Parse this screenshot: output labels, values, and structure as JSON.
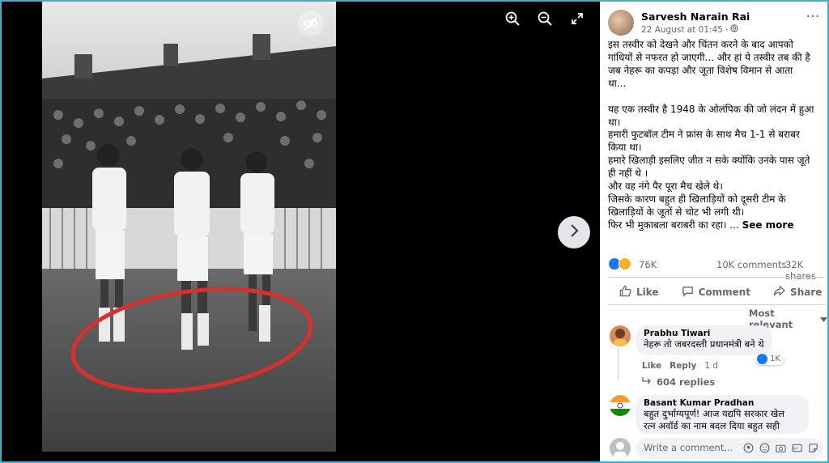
{
  "post": {
    "author": "Sarvesh Narain Rai",
    "timestamp": "22 August at 01:45",
    "privacy_separator": "·",
    "lines": [
      "इस तस्वीर को देखने और चिंतन करने के बाद आपको",
      "गांधियों से नफरत हो जाएगी... और हां ये तस्वीर तब की है",
      "जब नेहरू का कपड़ा और जूता विशेष विमान से आता",
      "था...",
      "",
      "यह एक तस्वीर है 1948 के ओलंपिक की जो लंदन में हुआ",
      "था।",
      "हमारी फुटबॉल टीम ने फ्रांस के साथ मैच 1-1 से बराबर",
      "किया था।",
      "हमारे खिलाड़ी इसलिए जीत न सके क्योंकि उनके पास जूते",
      "ही नहीं थे ।",
      "और वह नंगे पैर पूरा मैच खेले थे।",
      "जिसके कारण बहुत ही खिलाड़ियों को दूसरी टीम के",
      "खिलाड़ियों के जूतों से चोट भी लगी थी।"
    ],
    "last_line": "फिर भी मुकाबला बराबरी का रहा। ...",
    "see_more": "See more"
  },
  "stats": {
    "reactions": "76K",
    "comments": "10K comments",
    "shares": "32K shares"
  },
  "actions": {
    "like": "Like",
    "comment": "Comment",
    "share": "Share"
  },
  "sort_label": "Most relevant",
  "comments": [
    {
      "name": "Prabhu Tiwari",
      "text": "नेहरू तो जबरदस्ती प्रधानमंत्री बने थे",
      "like_label": "Like",
      "reply_label": "Reply",
      "time": "1 d",
      "likes": "1K",
      "replies": "604 replies"
    },
    {
      "name": "Basant Kumar Pradhan",
      "text_line1": "बहुत दुर्भाग्यपूर्ण! आज यद्यपि सरकार खेल",
      "text_line2": "रत्न अवॉर्ड का नाम बदल दिया बहुत सही"
    }
  ],
  "write_placeholder": "Write a comment...",
  "icons": {
    "zoom_in": "zoom-in-icon",
    "zoom_out": "zoom-out-icon",
    "fullscreen": "fullscreen-icon",
    "hide": "eye-slash-icon",
    "next": "chevron-right-icon"
  },
  "colors": {
    "frame": "#40b0c8",
    "annotation_circle": "#d9302c",
    "brand_blue": "#1877f2"
  }
}
